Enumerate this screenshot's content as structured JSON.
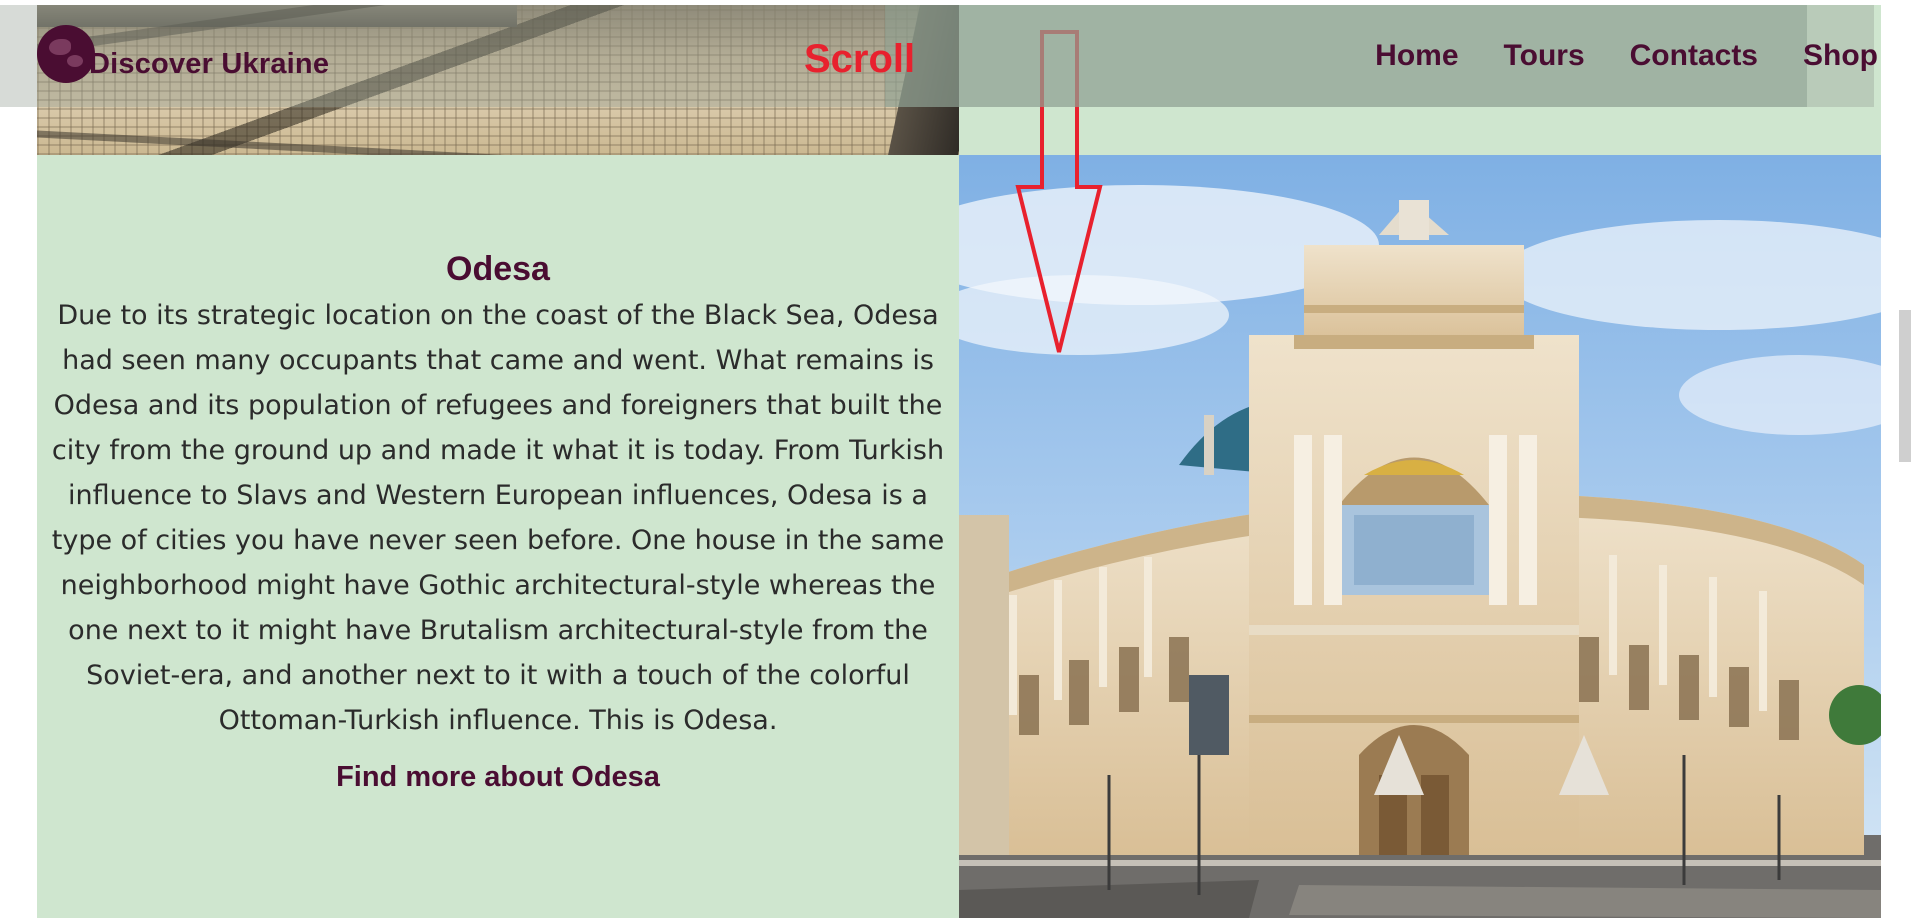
{
  "brand": {
    "name": "Discover Ukraine",
    "icon": "globe-icon"
  },
  "annotation": {
    "scroll_label": "Scroll",
    "arrow_color": "#e8212e"
  },
  "nav": {
    "items": [
      "Home",
      "Tours",
      "Contacts",
      "Shop"
    ]
  },
  "article": {
    "title": "Odesa",
    "body": "Due to its strategic location on the coast of the Black Sea, Odesa had seen many occupants that came and went. What remains is Odesa and its population of refugees and foreigners that built the city from the ground up and made it what it is today. From Turkish influence to Slavs and Western European influences, Odesa is a type of cities you have never seen before. One house in the same neighborhood might have Gothic architectural-style whereas the one next to it might have Brutalism architectural-style from the Soviet-era, and another next to it with a touch of the colorful Ottoman-Turkish influence. This is Odesa.",
    "link": "Find more about Odesa"
  },
  "colors": {
    "brand": "#4a0d32",
    "mint": "#cfe6cf",
    "accent": "#e8212e"
  }
}
